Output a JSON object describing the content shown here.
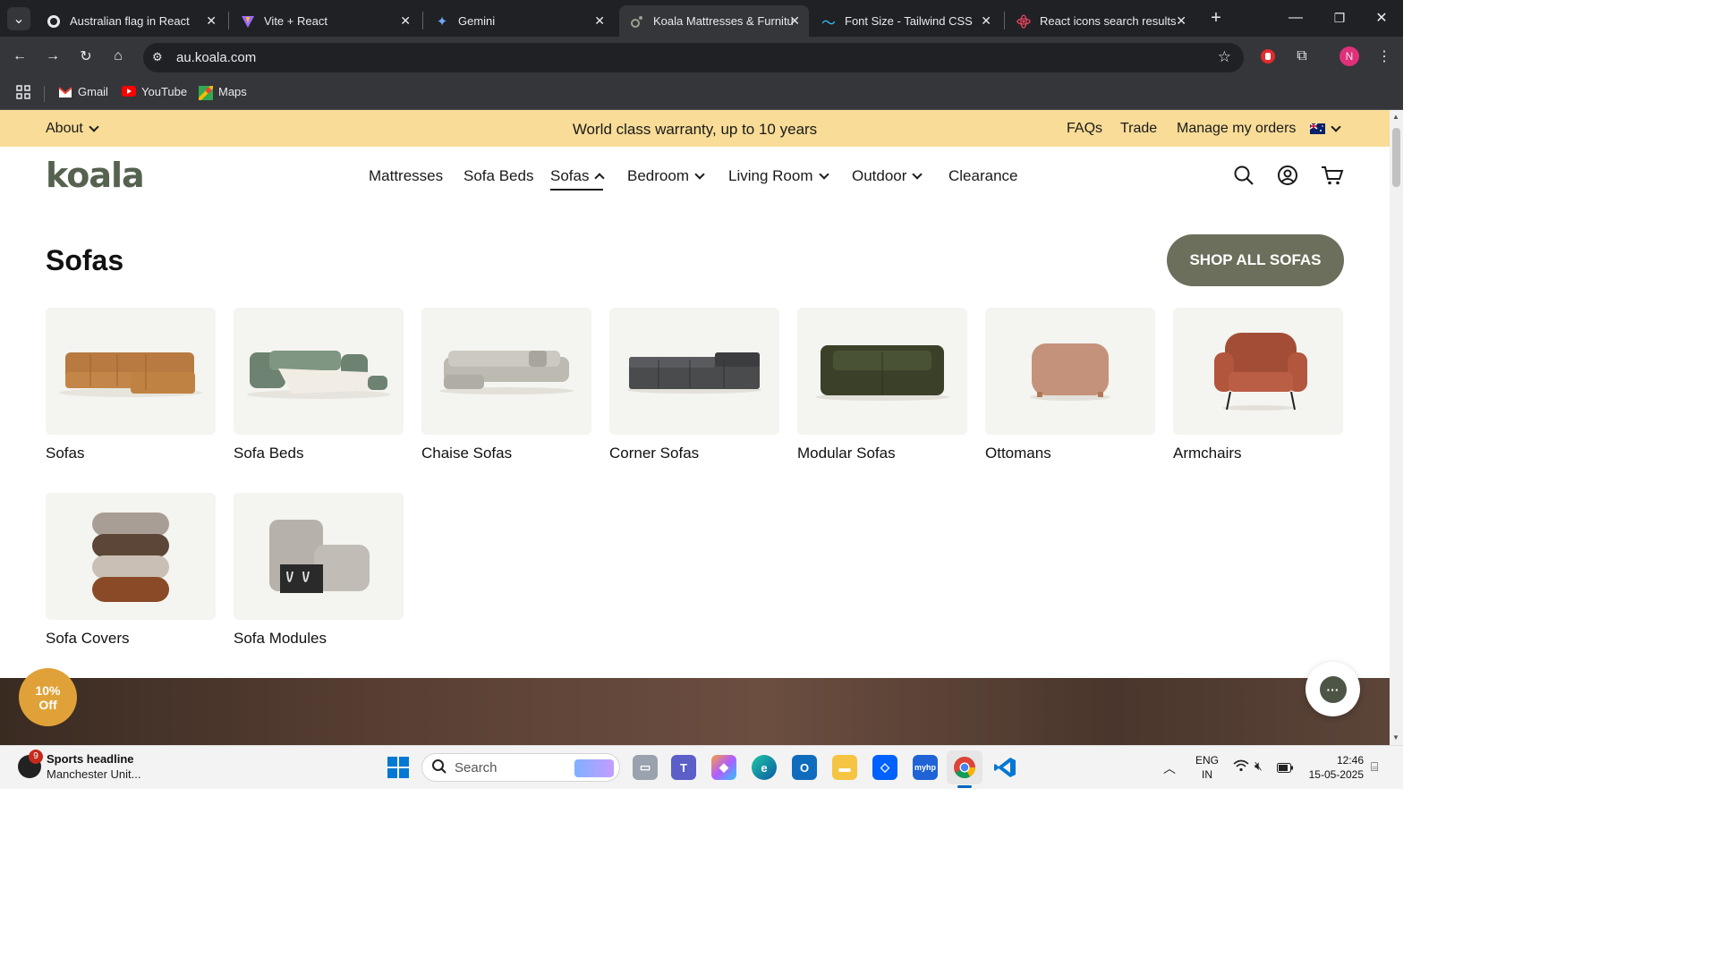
{
  "browser": {
    "tabs": [
      {
        "title": "Australian flag in React",
        "favicon": "github-icon"
      },
      {
        "title": "Vite + React",
        "favicon": "vite-icon"
      },
      {
        "title": "Gemini",
        "favicon": "gemini-icon"
      },
      {
        "title": "Koala Mattresses & Furnitu",
        "favicon": "koala-icon",
        "active": true
      },
      {
        "title": "Font Size - Tailwind CSS",
        "favicon": "tailwind-icon"
      },
      {
        "title": "React icons search results",
        "favicon": "react-icons-icon"
      }
    ],
    "url": "au.koala.com",
    "profile_initial": "N",
    "bookmarks": [
      {
        "label": "Gmail",
        "icon": "gmail-icon"
      },
      {
        "label": "YouTube",
        "icon": "youtube-icon"
      },
      {
        "label": "Maps",
        "icon": "maps-icon"
      }
    ]
  },
  "announcement": {
    "about": "About",
    "message": "World class warranty, up to 10 years",
    "faqs": "FAQs",
    "trade": "Trade",
    "manage_orders": "Manage my orders",
    "region_icon": "australia-flag-icon"
  },
  "header": {
    "logo": "koala",
    "nav": [
      {
        "label": "Mattresses",
        "dropdown": false
      },
      {
        "label": "Sofa Beds",
        "dropdown": false
      },
      {
        "label": "Sofas",
        "dropdown": true,
        "active": true
      },
      {
        "label": "Bedroom",
        "dropdown": true
      },
      {
        "label": "Living Room",
        "dropdown": true
      },
      {
        "label": "Outdoor",
        "dropdown": true
      },
      {
        "label": "Clearance",
        "dropdown": false
      }
    ]
  },
  "menu": {
    "title": "Sofas",
    "cta": "SHOP ALL SOFAS",
    "categories": [
      {
        "label": "Sofas",
        "image": "modular-sofa-tan"
      },
      {
        "label": "Sofa Beds",
        "image": "sofa-bed-sage"
      },
      {
        "label": "Chaise Sofas",
        "image": "chaise-sofa-grey"
      },
      {
        "label": "Corner Sofas",
        "image": "corner-sofa-charcoal"
      },
      {
        "label": "Modular Sofas",
        "image": "modular-sofa-olive"
      },
      {
        "label": "Ottomans",
        "image": "ottoman-clay"
      },
      {
        "label": "Armchairs",
        "image": "armchair-rust"
      },
      {
        "label": "Sofa Covers",
        "image": "sofa-covers-stack"
      },
      {
        "label": "Sofa Modules",
        "image": "sofa-module-grey"
      }
    ]
  },
  "promo": {
    "discount_line1": "10%",
    "discount_line2": "Off"
  },
  "colors": {
    "announcement_bg": "#f8dc97",
    "brand_green": "#566250",
    "cta_bg": "#6b6f5b",
    "promo_orange": "#e0a238"
  },
  "taskbar": {
    "news_badge": "9",
    "news_title": "Sports headline",
    "news_sub": "Manchester Unit...",
    "search_placeholder": "Search",
    "lang_1": "ENG",
    "lang_2": "IN",
    "time": "12:46",
    "date": "15-05-2025"
  }
}
